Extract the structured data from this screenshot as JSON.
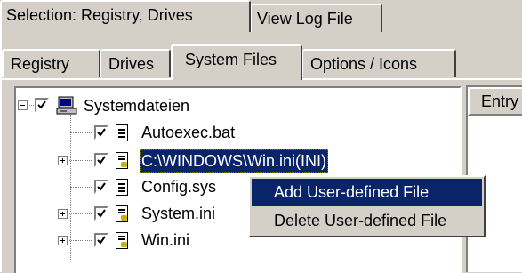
{
  "top_tabs": [
    {
      "label": "Selection: Registry, Drives",
      "active": true
    },
    {
      "label": "View Log File",
      "active": false
    }
  ],
  "sub_tabs": [
    {
      "label": "Registry",
      "active": false
    },
    {
      "label": "Drives",
      "active": false
    },
    {
      "label": "System Files",
      "active": true
    },
    {
      "label": "Options / Icons",
      "active": false
    }
  ],
  "tree": {
    "root": {
      "label": "Systemdateien",
      "checked": true,
      "icon": "computer-icon",
      "expanded": true
    },
    "children": [
      {
        "label": "Autoexec.bat",
        "checked": true,
        "icon": "text-file-icon",
        "expandable": false,
        "selected": false
      },
      {
        "label": "C:\\WINDOWS\\Win.ini(INI)",
        "checked": true,
        "icon": "ini-file-icon",
        "expandable": true,
        "selected": true
      },
      {
        "label": "Config.sys",
        "checked": true,
        "icon": "text-file-icon",
        "expandable": false,
        "selected": false
      },
      {
        "label": "System.ini",
        "checked": true,
        "icon": "ini-file-icon",
        "expandable": true,
        "selected": false
      },
      {
        "label": "Win.ini",
        "checked": true,
        "icon": "ini-file-icon",
        "expandable": true,
        "selected": false
      }
    ]
  },
  "list_header": {
    "label": "Entry"
  },
  "context_menu": {
    "items": [
      {
        "label": "Add User-defined File",
        "highlighted": true
      },
      {
        "label": "Delete User-defined File",
        "highlighted": false
      }
    ]
  },
  "colors": {
    "face": "#d4d0c8",
    "selection": "#0a246a",
    "window": "#ffffff"
  }
}
